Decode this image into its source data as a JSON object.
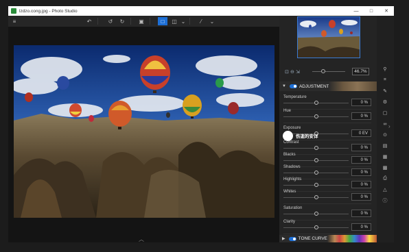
{
  "window": {
    "title": "lzdzo.cong.jpg - Photo Studio",
    "controls": {
      "minimize": "—",
      "maximize": "□",
      "close": "✕"
    }
  },
  "toolbar": {
    "icons": [
      "menu-icon",
      "undo-icon",
      "rotate-left-icon",
      "rotate-right-icon",
      "save-icon",
      "single-view-icon",
      "compare-view-icon",
      "dropdown-icon",
      "magic-tool-icon",
      "dropdown-icon"
    ]
  },
  "navigator": {
    "zoom_value": "46.7%"
  },
  "adjustments": {
    "title": "ADJUSTMENTS",
    "enabled": true,
    "sliders": [
      {
        "label": "Temperature",
        "value": "0 %",
        "level": 0.5
      },
      {
        "label": "Hue",
        "value": "0 %",
        "level": 0.5
      },
      {
        "label": "Exposure",
        "value": "0 EV",
        "level": 0.5
      },
      {
        "label": "Contrast",
        "value": "0 %",
        "level": 0.5
      },
      {
        "label": "Blacks",
        "value": "0 %",
        "level": 0.5
      },
      {
        "label": "Shadows",
        "value": "0 %",
        "level": 0.5
      },
      {
        "label": "Highlights",
        "value": "0 %",
        "level": 0.5
      },
      {
        "label": "Whites",
        "value": "0 %",
        "level": 0.5
      },
      {
        "label": "Saturation",
        "value": "0 %",
        "level": 0.5
      },
      {
        "label": "Clarity",
        "value": "0 %",
        "level": 0.5
      }
    ]
  },
  "tone_curves": {
    "title": "TONE CURVES",
    "enabled": true
  },
  "watermark": {
    "text": "伤逝的安详"
  },
  "colors": {
    "accent": "#1d6fd6",
    "panel_bg": "#242424",
    "window_bg": "#202020"
  }
}
